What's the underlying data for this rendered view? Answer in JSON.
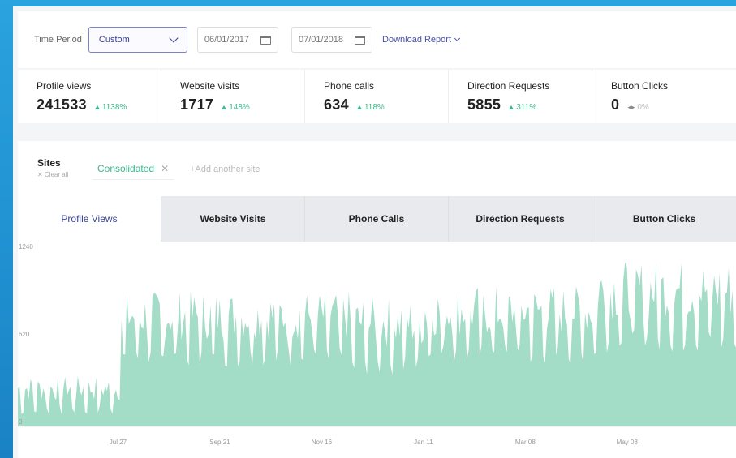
{
  "toolbar": {
    "time_period_label": "Time Period",
    "period_select": "Custom",
    "start_date": "06/01/2017",
    "end_date": "07/01/2018",
    "download_label": "Download Report"
  },
  "metrics": [
    {
      "label": "Profile views",
      "value": "241533",
      "change": "1138%"
    },
    {
      "label": "Website visits",
      "value": "1717",
      "change": "148%"
    },
    {
      "label": "Phone calls",
      "value": "634",
      "change": "118%"
    },
    {
      "label": "Direction Requests",
      "value": "5855",
      "change": "311%"
    },
    {
      "label": "Button Clicks",
      "value": "0",
      "change": "0%"
    }
  ],
  "sites": {
    "title": "Sites",
    "clear_label": "✕ Clear all",
    "chip_label": "Consolidated",
    "add_placeholder": "+Add another site"
  },
  "tabs": [
    "Profile Views",
    "Website Visits",
    "Phone Calls",
    "Direction Requests",
    "Button Clicks"
  ],
  "colors": {
    "accent": "#3a4196",
    "positive": "#3db889",
    "area_fill": "#a3dcc7"
  },
  "chart_data": {
    "type": "area",
    "y_ticks": [
      "1240",
      "620",
      "0"
    ],
    "ylim": [
      0,
      1240
    ],
    "x_ticks": [
      "Jul 27",
      "Sep 21",
      "Nov 16",
      "Jan 11",
      "Mar 08",
      "May 03"
    ],
    "x_range": [
      "2017-06-01",
      "2018-07-01"
    ],
    "series": [
      {
        "segments": [
          {
            "from": "2017-06-01",
            "to": "2017-07-27",
            "low": 80,
            "high": 360
          },
          {
            "from": "2017-07-28",
            "to": "2017-11-30",
            "low": 420,
            "high": 960
          },
          {
            "from": "2017-12-01",
            "to": "2018-01-10",
            "low": 360,
            "high": 920
          },
          {
            "from": "2018-01-11",
            "to": "2018-04-15",
            "low": 440,
            "high": 1000
          },
          {
            "from": "2018-04-16",
            "to": "2018-07-01",
            "low": 520,
            "high": 1180
          }
        ]
      }
    ]
  }
}
